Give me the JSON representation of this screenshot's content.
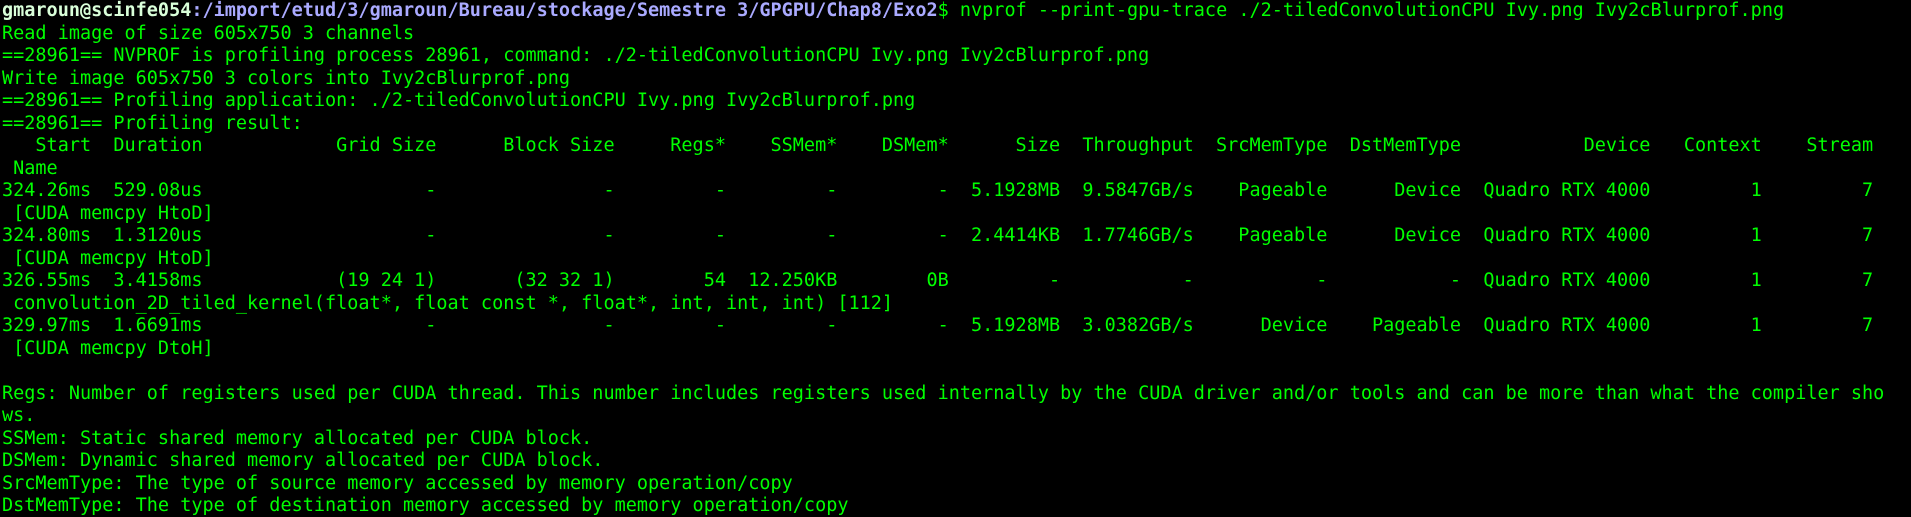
{
  "terminal": {
    "prompt": {
      "user_host": "gmaroun@scinfe054",
      "separator": ":",
      "cwd": "/import/etud/3/gmaroun/Bureau/stockage/Semestre 3/GPGPU/Chap8/Exo2",
      "symbol": "$ ",
      "command": "nvprof --print-gpu-trace ./2-tiledConvolutionCPU Ivy.png Ivy2cBlurprof.png"
    },
    "lines": [
      "Read image of size 605x750 3 channels",
      "==28961== NVPROF is profiling process 28961, command: ./2-tiledConvolutionCPU Ivy.png Ivy2cBlurprof.png",
      "Write image 605x750 3 colors into Ivy2cBlurprof.png",
      "==28961== Profiling application: ./2-tiledConvolutionCPU Ivy.png Ivy2cBlurprof.png",
      "==28961== Profiling result:",
      "   Start  Duration            Grid Size      Block Size     Regs*    SSMem*    DSMem*      Size  Throughput  SrcMemType  DstMemType           Device   Context    Stream",
      " Name",
      "324.26ms  529.08us                    -               -         -         -         -  5.1928MB  9.5847GB/s    Pageable      Device  Quadro RTX 4000         1         7",
      " [CUDA memcpy HtoD]",
      "324.80ms  1.3120us                    -               -         -         -         -  2.4414KB  1.7746GB/s    Pageable      Device  Quadro RTX 4000         1         7",
      " [CUDA memcpy HtoD]",
      "326.55ms  3.4158ms            (19 24 1)       (32 32 1)        54  12.250KB        0B         -           -           -           -  Quadro RTX 4000         1         7",
      " convolution_2D_tiled_kernel(float*, float const *, float*, int, int, int) [112]",
      "329.97ms  1.6691ms                    -               -         -         -         -  5.1928MB  3.0382GB/s      Device    Pageable  Quadro RTX 4000         1         7",
      " [CUDA memcpy DtoH]",
      "",
      "Regs: Number of registers used per CUDA thread. This number includes registers used internally by the CUDA driver and/or tools and can be more than what the compiler sho",
      "ws.",
      "SSMem: Static shared memory allocated per CUDA block.",
      "DSMem: Dynamic shared memory allocated per CUDA block.",
      "SrcMemType: The type of source memory accessed by memory operation/copy",
      "DstMemType: The type of destination memory accessed by memory operation/copy"
    ]
  }
}
